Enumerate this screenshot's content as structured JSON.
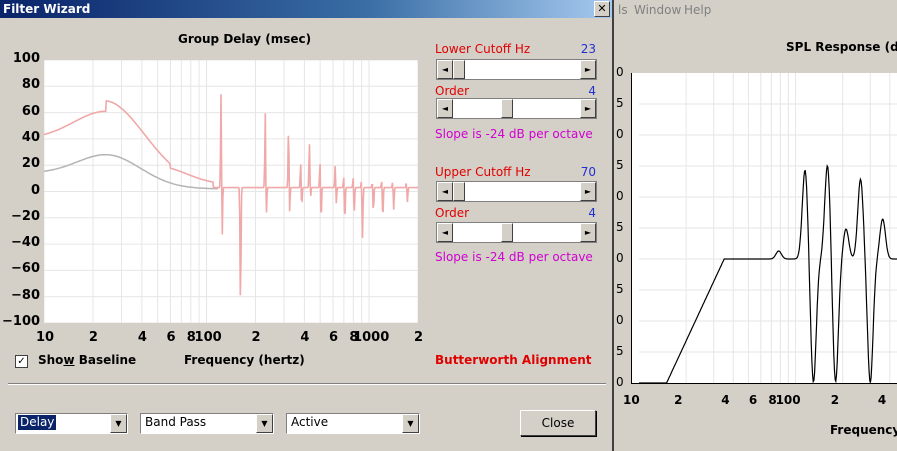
{
  "window": {
    "title": "Filter Wizard",
    "close_glyph": "✕"
  },
  "background_app": {
    "menu": [
      {
        "label": "ls"
      },
      {
        "label": "Window"
      },
      {
        "label": "Help"
      }
    ],
    "spl_title": "SPL Response (dB)",
    "xlabel": "Frequency (",
    "x_ticks": [
      "10",
      "2",
      "4",
      "6",
      "8",
      "100",
      "2",
      "4"
    ],
    "y_ticks": [
      "0",
      "5",
      "0",
      "5",
      "0",
      "5",
      "0",
      "5",
      "0",
      "5",
      "0"
    ]
  },
  "group_delay": {
    "title": "Group Delay (msec)",
    "xlabel": "Frequency (hertz)",
    "y_ticks": [
      "100",
      "80",
      "60",
      "40",
      "20",
      "0",
      "−20",
      "−40",
      "−60",
      "−80",
      "−100"
    ],
    "x_ticks": [
      "10",
      "2",
      "4",
      "6",
      "8",
      "100",
      "2",
      "4",
      "6",
      "8",
      "1000",
      "2"
    ]
  },
  "controls": {
    "lower_cutoff_label": "Lower Cutoff  Hz",
    "lower_cutoff_value": "23",
    "lower_order_label": "Order",
    "lower_order_value": "4",
    "lower_slope": "Slope is -24 dB per octave",
    "upper_cutoff_label": "Upper Cutoff  Hz",
    "upper_cutoff_value": "70",
    "upper_order_label": "Order",
    "upper_order_value": "4",
    "upper_slope": "Slope is -24 dB per octave",
    "show_baseline": {
      "before": "Sho",
      "underlined": "w",
      "after": " Baseline",
      "checked": true
    },
    "alignment": "Butterworth Alignment",
    "response_combo": "Delay",
    "filter_type_combo": "Band Pass",
    "mode_combo": "Active",
    "close_button": "Close",
    "arrow_left": "◄",
    "arrow_right": "►",
    "arrow_down": "▼",
    "check_glyph": "✓"
  },
  "colors": {
    "title_gradient_start": "#0a246a",
    "gd_curve": "#f0a8a8",
    "baseline_curve": "#b4b4b4",
    "label_red": "#e00000",
    "value_blue": "#2030d0",
    "slope_magenta": "#d000d0"
  }
}
